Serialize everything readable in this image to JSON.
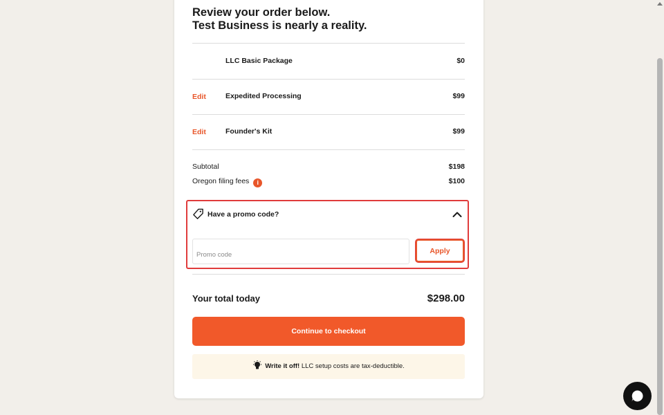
{
  "order": {
    "heading_line1": "Review your order below.",
    "heading_line2": "Test Business is nearly a reality.",
    "items": [
      {
        "edit": "",
        "name": "LLC Basic Package",
        "price": "$0"
      },
      {
        "edit": "Edit",
        "name": "Expedited Processing",
        "price": "$99"
      },
      {
        "edit": "Edit",
        "name": "Founder's Kit",
        "price": "$99"
      }
    ],
    "subtotal_label": "Subtotal",
    "subtotal_value": "$198",
    "fees_label": "Oregon filing fees",
    "fees_info": "i",
    "fees_value": "$100"
  },
  "promo": {
    "title": "Have a promo code?",
    "placeholder": "Promo code",
    "value": "",
    "apply_label": "Apply",
    "tag_icon": "tag-icon",
    "toggle_icon": "chevron-up-icon"
  },
  "total": {
    "label": "Your total today",
    "value": "$298.00"
  },
  "checkout": {
    "label": "Continue to checkout"
  },
  "tip": {
    "icon": "lightbulb-icon",
    "bold": "Write it off!",
    "text": " LLC setup costs are tax-deductible."
  },
  "chat": {
    "icon": "chat-bubble-icon"
  },
  "colors": {
    "accent": "#f1592a",
    "highlight_border": "#e03b3b",
    "background": "#f2efea",
    "tip_background": "#fdf6e8"
  }
}
